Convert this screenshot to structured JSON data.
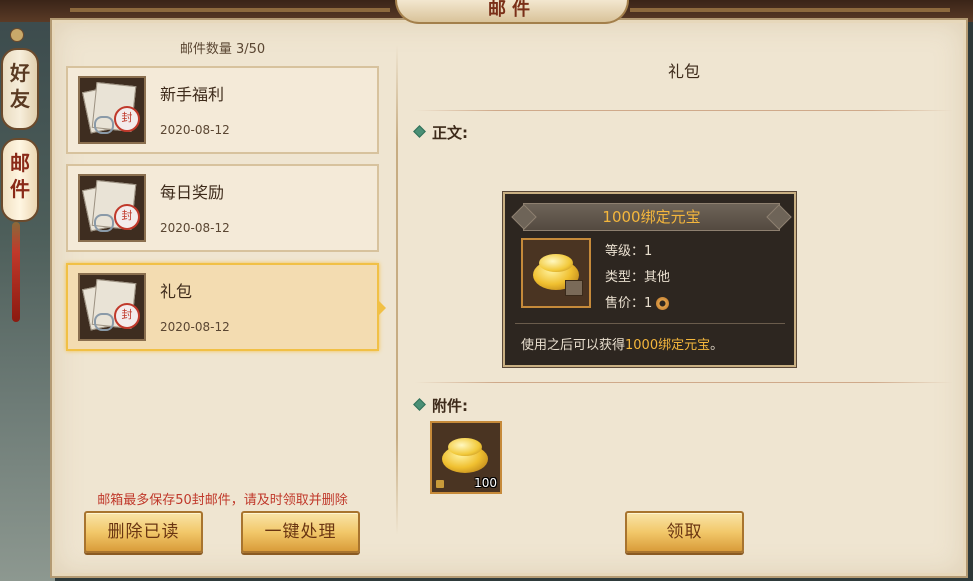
{
  "window": {
    "title": "邮件"
  },
  "side_tabs": [
    {
      "label": "好友",
      "chars": [
        "好",
        "友"
      ]
    },
    {
      "label": "邮件",
      "chars": [
        "邮",
        "件"
      ]
    }
  ],
  "mail_list": {
    "count_text": "邮件数量 3/50",
    "items": [
      {
        "title": "新手福利",
        "date": "2020-08-12",
        "selected": false,
        "seal": "封"
      },
      {
        "title": "每日奖励",
        "date": "2020-08-12",
        "selected": false,
        "seal": "封"
      },
      {
        "title": "礼包",
        "date": "2020-08-12",
        "selected": true,
        "seal": "封"
      }
    ],
    "warning": "邮箱最多保存50封邮件，请及时领取并删除",
    "delete_read_label": "删除已读",
    "one_click_label": "一键处理"
  },
  "mail_detail": {
    "heading": "礼包",
    "body_label": "正文:",
    "item_tooltip": {
      "name": "1000绑定元宝",
      "level_label": "等级：",
      "level_value": "1",
      "type_label": "类型：",
      "type_value": "其他",
      "price_label": "售价：",
      "price_value": "1",
      "desc_prefix": "使用之后可以获得",
      "desc_highlight": "1000绑定元宝",
      "desc_suffix": "。",
      "name_color": "#f4b63c"
    },
    "attachment_label": "附件:",
    "attachment_qty": "100",
    "claim_label": "领取"
  },
  "colors": {
    "accent_gold": "#f1c045",
    "warning_red": "#c0392b",
    "panel_bg": "#efe5d1"
  }
}
